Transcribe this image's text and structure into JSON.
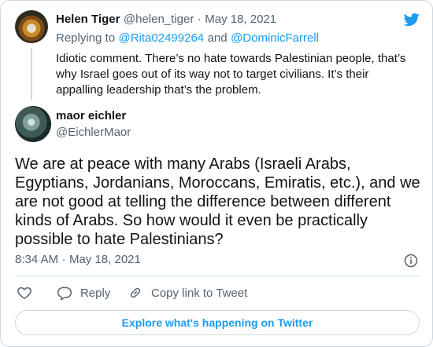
{
  "reply_tweet": {
    "author_name": "Helen Tiger",
    "author_handle": "@helen_tiger",
    "separator": "·",
    "date": "May 18, 2021",
    "replying_prefix": "Replying to",
    "mention_1": "@Rita02499264",
    "and_word": "and",
    "mention_2": "@DominicFarrell",
    "text": "Idiotic comment. There’s no hate towards Palestinian people, that’s why Israel goes out of its way not to target civilians. It’s their appalling leadership that’s the problem."
  },
  "main_tweet": {
    "author_name": "maor eichler",
    "author_handle": "@EichlerMaor",
    "text": "We are at peace with many Arabs (Israeli Arabs, Egyptians, Jordanians, Moroccans, Emiratis, etc.), and we are not good at telling the difference between different kinds of Arabs. So how would it even be practically possible to hate Palestinians?",
    "time": "8:34 AM",
    "separator": "·",
    "date": "May 18, 2021"
  },
  "actions": {
    "reply_label": "Reply",
    "copy_link_label": "Copy link to Tweet"
  },
  "explore_label": "Explore what's happening on Twitter",
  "colors": {
    "accent": "#1d9bf0",
    "text": "#0f1419",
    "muted": "#536471",
    "border": "#cfd9de"
  },
  "icons": [
    "twitter-bird-icon",
    "info-icon",
    "heart-icon",
    "reply-bubble-icon",
    "link-icon"
  ]
}
